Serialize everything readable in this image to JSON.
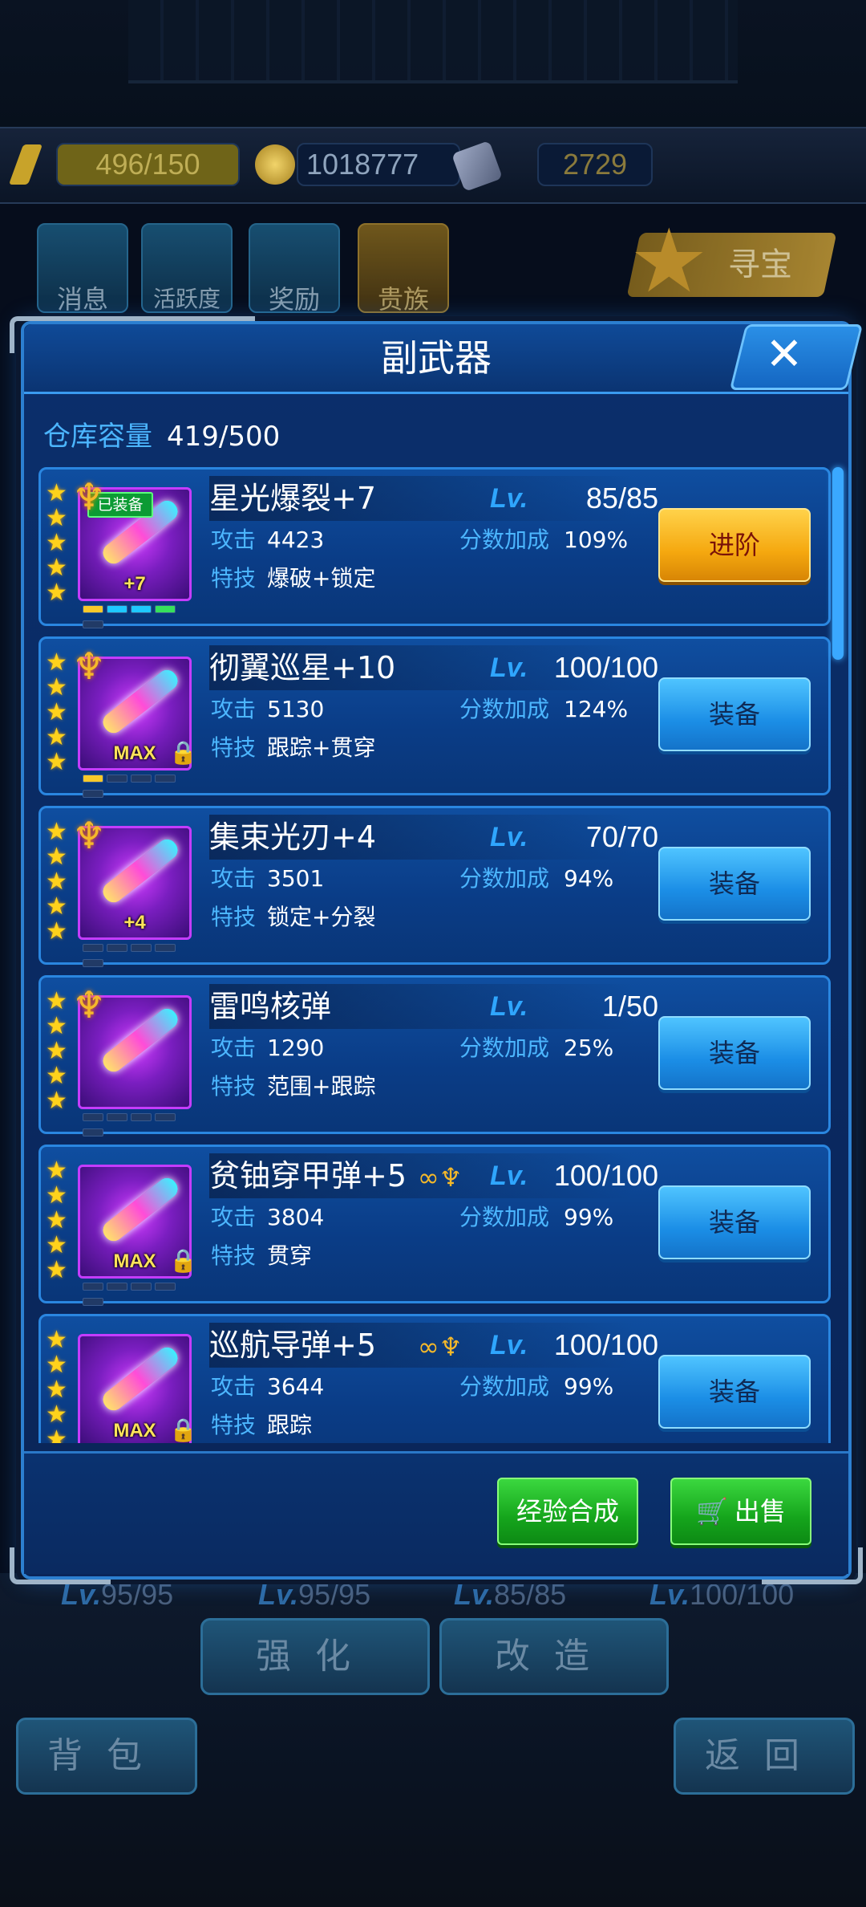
{
  "resources": {
    "energy": "496/150",
    "gold": "1018777",
    "gems": "2729"
  },
  "top_buttons": [
    "消息",
    "活跃度",
    "奖励",
    "贵族"
  ],
  "treasure_label": "寻宝",
  "dialog": {
    "title": "副武器",
    "capacity_label": "仓库容量",
    "capacity_value": "419/500",
    "attack_label": "攻击",
    "bonus_label": "分数加成",
    "skill_label": "特技",
    "lv_label": "Lv.",
    "items": [
      {
        "name": "星光爆裂+7",
        "lv": "85/85",
        "attack": "4423",
        "bonus": "109%",
        "skill": "爆破+锁定",
        "button": "进阶",
        "stars": 5,
        "tag": "+7",
        "equipped_badge": "已装备",
        "locked": false,
        "set_bonus": false
      },
      {
        "name": "彻翼巡星+10",
        "lv": "100/100",
        "attack": "5130",
        "bonus": "124%",
        "skill": "跟踪+贯穿",
        "button": "装备",
        "stars": 5,
        "tag": "MAX",
        "locked": true,
        "set_bonus": false
      },
      {
        "name": "集束光刃+4",
        "lv": "70/70",
        "attack": "3501",
        "bonus": "94%",
        "skill": "锁定+分裂",
        "button": "装备",
        "stars": 5,
        "tag": "+4",
        "locked": false,
        "set_bonus": false
      },
      {
        "name": "雷鸣核弹",
        "lv": "1/50",
        "attack": "1290",
        "bonus": "25%",
        "skill": "范围+跟踪",
        "button": "装备",
        "stars": 5,
        "tag": "",
        "locked": false,
        "set_bonus": false
      },
      {
        "name": "贫铀穿甲弹+5",
        "lv": "100/100",
        "attack": "3804",
        "bonus": "99%",
        "skill": "贯穿",
        "button": "装备",
        "stars": 5,
        "tag": "MAX",
        "locked": true,
        "set_bonus": true
      },
      {
        "name": "巡航导弹+5",
        "lv": "100/100",
        "attack": "3644",
        "bonus": "99%",
        "skill": "跟踪",
        "button": "装备",
        "stars": 5,
        "tag": "MAX",
        "locked": true,
        "set_bonus": true
      }
    ],
    "footer": {
      "exp_merge": "经验合成",
      "sell": "出售"
    }
  },
  "background_levels": [
    "95/95",
    "95/95",
    "85/85",
    "100/100"
  ],
  "bottom_buttons": {
    "strengthen": "强化",
    "modify": "改造",
    "backpack": "背包",
    "back": "返回"
  },
  "colors": {
    "accent_blue": "#2fa6ff",
    "gold": "#ffd21c",
    "advance_button": "#f5a80f",
    "equip_button": "#1b8ee6",
    "green_button": "#15a51c"
  }
}
